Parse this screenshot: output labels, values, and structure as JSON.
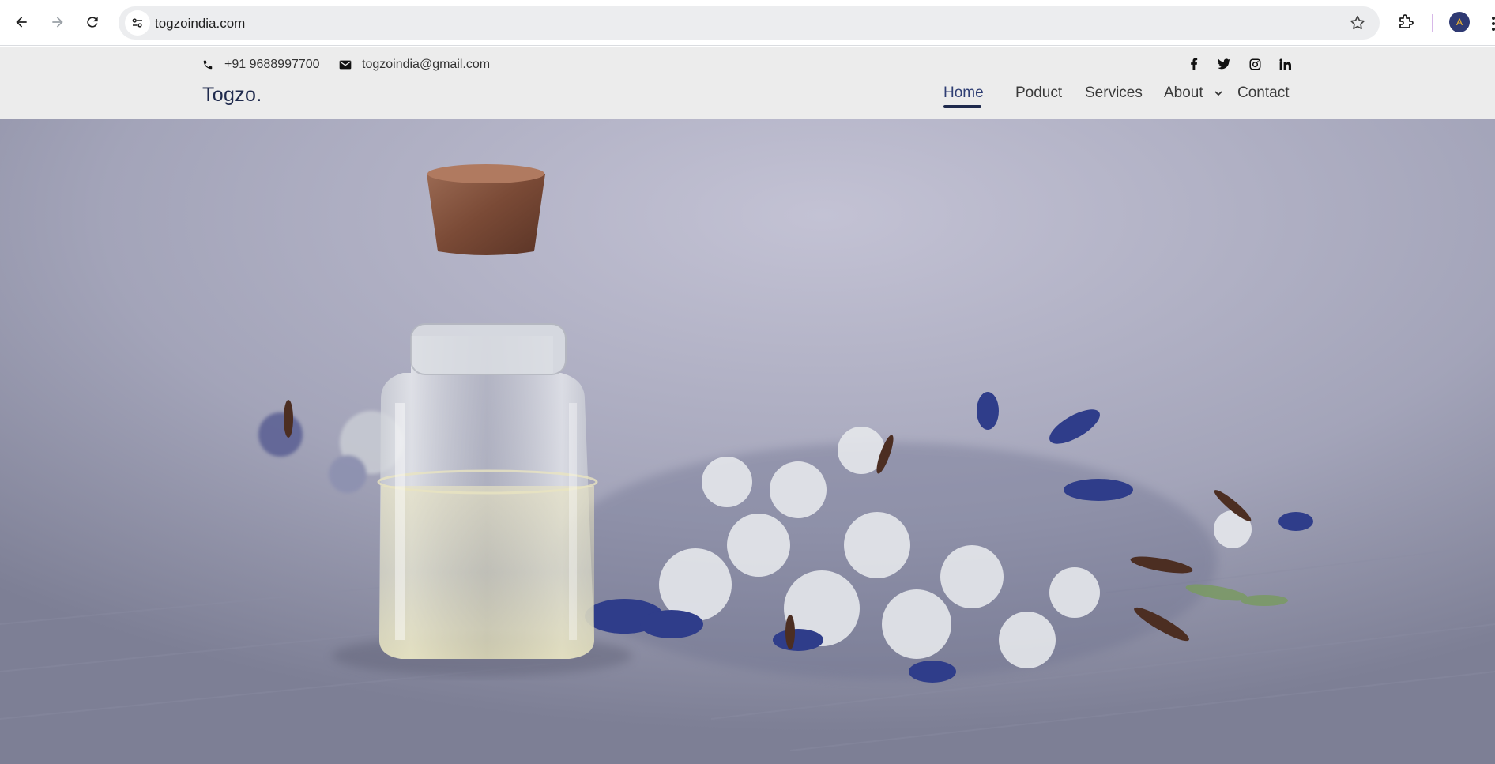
{
  "browser": {
    "url": "togzoindia.com",
    "profile_initial": "A"
  },
  "topbar": {
    "phone": "+91 9688997700",
    "email": "togzoindia@gmail.com",
    "social_icons": [
      "facebook-icon",
      "twitter-icon",
      "instagram-icon",
      "linkedin-icon"
    ]
  },
  "header": {
    "brand": "Togzo.",
    "menu": {
      "home": "Home",
      "product": "Poduct",
      "services": "Services",
      "about": "About",
      "contact": "Contact"
    },
    "active_item": "Home"
  },
  "colors": {
    "header_bg": "#ececec",
    "brand": "#1f2a4d",
    "active_underline": "#1f2a4d"
  }
}
